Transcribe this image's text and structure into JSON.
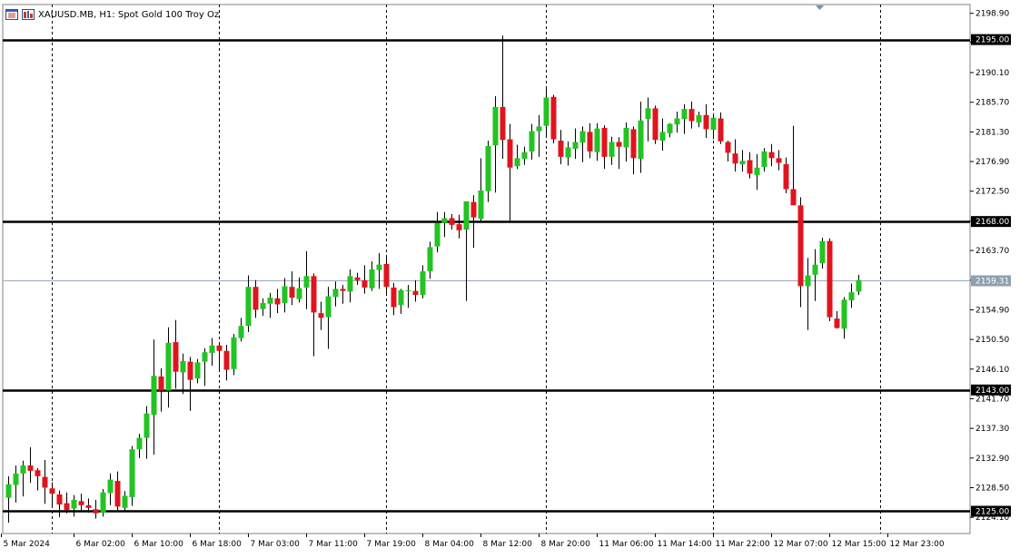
{
  "header": {
    "symbol": "XAUUSD.MB",
    "timeframe": "H1",
    "description": "Spot Gold 100 Troy Oz",
    "icons": [
      "chart-menu-icon",
      "one-click-trading-icon"
    ]
  },
  "chart_data": {
    "type": "candlestick",
    "ylim": [
      2121.7,
      2200.2
    ],
    "y_ticks": [
      "2198.90",
      "2194.60",
      "2190.10",
      "2185.70",
      "2181.30",
      "2176.90",
      "2172.50",
      "2168.10",
      "2163.70",
      "2159.30",
      "2154.90",
      "2150.50",
      "2146.10",
      "2141.70",
      "2137.30",
      "2132.90",
      "2128.50",
      "2124.10"
    ],
    "x_tick_labels": [
      {
        "label": "5 Mar 2024",
        "index": 0
      },
      {
        "label": "6 Mar 02:00",
        "index": 10
      },
      {
        "label": "6 Mar 10:00",
        "index": 18
      },
      {
        "label": "6 Mar 18:00",
        "index": 26
      },
      {
        "label": "7 Mar 03:00",
        "index": 34
      },
      {
        "label": "7 Mar 11:00",
        "index": 42
      },
      {
        "label": "7 Mar 19:00",
        "index": 50
      },
      {
        "label": "8 Mar 04:00",
        "index": 58
      },
      {
        "label": "8 Mar 12:00",
        "index": 66
      },
      {
        "label": "8 Mar 20:00",
        "index": 74
      },
      {
        "label": "11 Mar 06:00",
        "index": 82
      },
      {
        "label": "11 Mar 14:00",
        "index": 90
      },
      {
        "label": "11 Mar 22:00",
        "index": 98
      },
      {
        "label": "12 Mar 07:00",
        "index": 106
      },
      {
        "label": "12 Mar 15:00",
        "index": 114
      },
      {
        "label": "12 Mar 23:00",
        "index": 122
      }
    ],
    "vertical_separators": [
      7,
      30,
      53,
      75,
      98,
      121
    ],
    "horizontal_levels": [
      {
        "value": 2195.0,
        "label": "2195.00"
      },
      {
        "value": 2168.0,
        "label": "2168.00"
      },
      {
        "value": 2143.0,
        "label": "2143.00"
      },
      {
        "value": 2125.0,
        "label": "2125.00"
      }
    ],
    "current_price": {
      "value": 2159.31,
      "label": "2159.31"
    },
    "colors": {
      "bull": "#22c322",
      "bear": "#e0141e",
      "level": "#000000",
      "price_line": "#9aa9b8",
      "price_tag": "#8ea0b0"
    },
    "candles": [
      [
        2127.0,
        2130.2,
        2123.3,
        2129.0
      ],
      [
        2128.9,
        2131.8,
        2126.3,
        2130.6
      ],
      [
        2130.6,
        2132.5,
        2127.2,
        2131.8
      ],
      [
        2131.8,
        2134.5,
        2129.2,
        2131.0
      ],
      [
        2131.1,
        2131.4,
        2128.1,
        2130.2
      ],
      [
        2130.1,
        2132.6,
        2126.1,
        2128.5
      ],
      [
        2128.4,
        2129.3,
        2125.5,
        2127.6
      ],
      [
        2127.5,
        2128.1,
        2124.1,
        2126.0
      ],
      [
        2126.2,
        2127.8,
        2124.7,
        2125.2
      ],
      [
        2125.4,
        2127.4,
        2124.2,
        2126.7
      ],
      [
        2126.5,
        2127.6,
        2124.9,
        2125.9
      ],
      [
        2125.9,
        2126.9,
        2124.8,
        2125.5
      ],
      [
        2125.3,
        2126.7,
        2123.9,
        2124.7
      ],
      [
        2124.8,
        2128.3,
        2124.2,
        2127.8
      ],
      [
        2127.7,
        2130.6,
        2125.9,
        2129.7
      ],
      [
        2129.5,
        2130.9,
        2125.1,
        2125.7
      ],
      [
        2125.5,
        2128.0,
        2124.9,
        2127.3
      ],
      [
        2127.1,
        2134.7,
        2125.8,
        2134.2
      ],
      [
        2134.2,
        2136.5,
        2132.9,
        2135.9
      ],
      [
        2135.9,
        2140.6,
        2132.8,
        2139.5
      ],
      [
        2139.3,
        2150.5,
        2133.4,
        2145.1
      ],
      [
        2145.0,
        2146.2,
        2139.8,
        2142.9
      ],
      [
        2142.9,
        2152.3,
        2140.4,
        2150.0
      ],
      [
        2150.1,
        2153.4,
        2143.2,
        2145.7
      ],
      [
        2145.6,
        2148.4,
        2142.4,
        2147.3
      ],
      [
        2147.2,
        2147.9,
        2139.9,
        2144.5
      ],
      [
        2144.7,
        2147.6,
        2144.0,
        2147.1
      ],
      [
        2147.2,
        2149.2,
        2143.6,
        2148.6
      ],
      [
        2148.5,
        2150.7,
        2146.6,
        2149.6
      ],
      [
        2149.6,
        2150.1,
        2146.0,
        2148.8
      ],
      [
        2148.8,
        2149.7,
        2144.4,
        2146.0
      ],
      [
        2146.1,
        2151.3,
        2145.2,
        2150.8
      ],
      [
        2150.7,
        2153.7,
        2150.2,
        2152.5
      ],
      [
        2152.5,
        2160.0,
        2151.6,
        2158.3
      ],
      [
        2158.3,
        2159.3,
        2153.7,
        2154.9
      ],
      [
        2155.0,
        2156.6,
        2154.0,
        2155.9
      ],
      [
        2155.8,
        2157.4,
        2153.7,
        2156.7
      ],
      [
        2156.6,
        2158.0,
        2154.4,
        2155.7
      ],
      [
        2155.9,
        2159.6,
        2154.5,
        2158.4
      ],
      [
        2158.3,
        2160.6,
        2155.6,
        2156.7
      ],
      [
        2156.5,
        2159.7,
        2156.0,
        2158.1
      ],
      [
        2158.2,
        2163.6,
        2155.0,
        2159.9
      ],
      [
        2159.9,
        2160.3,
        2148.0,
        2154.5
      ],
      [
        2154.4,
        2156.1,
        2151.9,
        2153.7
      ],
      [
        2153.8,
        2158.3,
        2149.1,
        2156.9
      ],
      [
        2156.8,
        2159.1,
        2155.4,
        2158.0
      ],
      [
        2158.0,
        2158.6,
        2155.8,
        2157.7
      ],
      [
        2157.6,
        2160.9,
        2156.0,
        2159.9
      ],
      [
        2159.7,
        2160.4,
        2158.6,
        2159.3
      ],
      [
        2159.3,
        2161.5,
        2157.3,
        2158.2
      ],
      [
        2158.1,
        2162.1,
        2157.7,
        2160.9
      ],
      [
        2160.8,
        2163.3,
        2158.0,
        2161.6
      ],
      [
        2161.7,
        2163.0,
        2157.0,
        2158.3
      ],
      [
        2158.2,
        2158.9,
        2154.1,
        2155.3
      ],
      [
        2155.6,
        2158.0,
        2154.3,
        2157.8
      ],
      [
        2157.7,
        2158.6,
        2155.2,
        2157.8
      ],
      [
        2157.7,
        2159.3,
        2156.1,
        2157.1
      ],
      [
        2157.1,
        2161.5,
        2156.6,
        2160.6
      ],
      [
        2160.6,
        2165.0,
        2159.5,
        2164.2
      ],
      [
        2164.3,
        2169.4,
        2163.4,
        2167.8
      ],
      [
        2167.8,
        2169.4,
        2165.7,
        2168.5
      ],
      [
        2168.5,
        2169.1,
        2166.8,
        2167.5
      ],
      [
        2167.6,
        2169.0,
        2165.5,
        2166.7
      ],
      [
        2166.8,
        2170.0,
        2156.2,
        2171.0
      ],
      [
        2170.9,
        2171.9,
        2164.1,
        2168.6
      ],
      [
        2168.4,
        2177.4,
        2167.8,
        2172.6
      ],
      [
        2172.5,
        2180.0,
        2170.9,
        2179.2
      ],
      [
        2179.3,
        2186.6,
        2172.3,
        2185.0
      ],
      [
        2185.0,
        2195.6,
        2177.3,
        2180.1
      ],
      [
        2180.2,
        2182.5,
        2167.8,
        2176.0
      ],
      [
        2176.2,
        2179.4,
        2175.8,
        2177.4
      ],
      [
        2177.3,
        2179.1,
        2176.4,
        2178.3
      ],
      [
        2178.4,
        2182.5,
        2177.2,
        2181.4
      ],
      [
        2181.4,
        2183.8,
        2177.6,
        2182.1
      ],
      [
        2182.2,
        2187.8,
        2180.4,
        2186.4
      ],
      [
        2186.5,
        2186.8,
        2179.6,
        2180.2
      ],
      [
        2180.0,
        2181.6,
        2176.5,
        2177.6
      ],
      [
        2177.5,
        2179.9,
        2176.3,
        2179.0
      ],
      [
        2178.8,
        2181.8,
        2177.3,
        2179.8
      ],
      [
        2179.7,
        2182.1,
        2176.8,
        2181.4
      ],
      [
        2181.3,
        2182.6,
        2177.4,
        2178.4
      ],
      [
        2178.3,
        2182.6,
        2177.0,
        2181.8
      ],
      [
        2181.9,
        2182.3,
        2175.8,
        2177.6
      ],
      [
        2177.6,
        2180.6,
        2176.4,
        2179.8
      ],
      [
        2179.8,
        2180.5,
        2175.8,
        2179.1
      ],
      [
        2179.0,
        2182.7,
        2176.9,
        2181.9
      ],
      [
        2181.7,
        2182.1,
        2175.0,
        2177.4
      ],
      [
        2177.3,
        2185.8,
        2175.2,
        2183.0
      ],
      [
        2183.2,
        2186.4,
        2179.9,
        2184.8
      ],
      [
        2184.8,
        2185.2,
        2179.5,
        2180.1
      ],
      [
        2180.0,
        2183.3,
        2178.5,
        2181.3
      ],
      [
        2181.1,
        2182.6,
        2180.5,
        2182.5
      ],
      [
        2182.4,
        2184.3,
        2181.2,
        2183.3
      ],
      [
        2183.2,
        2185.4,
        2181.0,
        2184.7
      ],
      [
        2184.7,
        2185.8,
        2181.8,
        2182.9
      ],
      [
        2182.7,
        2184.3,
        2182.0,
        2183.8
      ],
      [
        2183.8,
        2185.4,
        2180.4,
        2181.7
      ],
      [
        2181.6,
        2184.0,
        2180.2,
        2183.4
      ],
      [
        2183.3,
        2184.2,
        2179.5,
        2179.9
      ],
      [
        2179.8,
        2180.0,
        2176.9,
        2178.2
      ],
      [
        2178.1,
        2180.2,
        2175.4,
        2176.6
      ],
      [
        2176.5,
        2178.6,
        2175.4,
        2177.0
      ],
      [
        2177.1,
        2178.3,
        2174.4,
        2175.1
      ],
      [
        2174.9,
        2178.0,
        2172.7,
        2176.0
      ],
      [
        2176.1,
        2178.9,
        2175.4,
        2178.4
      ],
      [
        2178.3,
        2179.5,
        2176.2,
        2177.4
      ],
      [
        2177.4,
        2178.6,
        2175.6,
        2176.7
      ],
      [
        2176.5,
        2177.5,
        2172.2,
        2172.8
      ],
      [
        2172.8,
        2182.2,
        2171.9,
        2170.4
      ],
      [
        2170.4,
        2171.6,
        2155.3,
        2158.4
      ],
      [
        2158.4,
        2162.6,
        2151.9,
        2160.0
      ],
      [
        2160.1,
        2163.9,
        2156.2,
        2161.6
      ],
      [
        2161.8,
        2165.6,
        2161.0,
        2165.1
      ],
      [
        2165.1,
        2165.5,
        2153.2,
        2153.8
      ],
      [
        2153.6,
        2154.7,
        2152.1,
        2152.2
      ],
      [
        2152.1,
        2156.8,
        2150.6,
        2156.4
      ],
      [
        2156.3,
        2158.8,
        2155.2,
        2157.5
      ],
      [
        2157.6,
        2160.1,
        2157.1,
        2159.3
      ]
    ]
  }
}
